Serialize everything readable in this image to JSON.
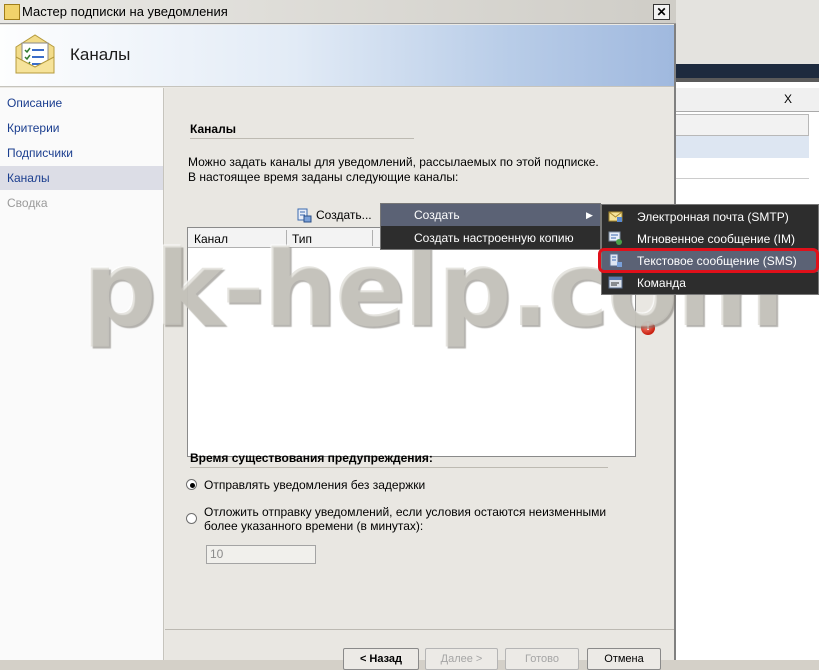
{
  "window": {
    "title": "Мастер подписки на уведомления"
  },
  "banner": {
    "title": "Каналы"
  },
  "sidebar": {
    "items": [
      {
        "label": "Описание"
      },
      {
        "label": "Критерии"
      },
      {
        "label": "Подписчики"
      },
      {
        "label": "Каналы"
      },
      {
        "label": "Сводка"
      }
    ],
    "selected": "Каналы"
  },
  "main": {
    "section_title": "Каналы",
    "description": "Можно задать каналы для уведомлений, рассылаемых по этой подписке. В настоящее время заданы следующие каналы:",
    "create_button": "Создать...",
    "grid": {
      "columns": [
        "Канал",
        "Тип"
      ]
    },
    "warning_section": {
      "title": "Время существования предупреждения:",
      "option1": "Отправлять уведомления без задержки",
      "option2": "Отложить отправку уведомлений, если условия остаются неизменными более указанного времени (в минутах):",
      "selected": "option1",
      "delay_value": "10"
    }
  },
  "buttons": {
    "back": "< Назад",
    "next": "Далее >",
    "finish": "Готово",
    "cancel": "Отмена"
  },
  "context_menu": {
    "items": [
      {
        "label": "Создать",
        "has_submenu": true
      },
      {
        "label": "Создать настроенную копию"
      }
    ]
  },
  "submenu": {
    "items": [
      {
        "label": "Электронная почта (SMTP)",
        "icon": "email-icon"
      },
      {
        "label": "Мгновенное сообщение (IM)",
        "icon": "instant-message-icon"
      },
      {
        "label": "Текстовое сообщение (SMS)",
        "icon": "sms-icon"
      },
      {
        "label": "Команда",
        "icon": "command-icon"
      }
    ],
    "highlighted": "Текстовое сообщение (SMS)"
  },
  "background_window": {
    "close_label": "X"
  },
  "watermark": "pk-help.com",
  "colors": {
    "menu_bg": "#2d2d2d",
    "menu_highlight": "#5b6275",
    "annotation_red": "#e0101a",
    "link_blue": "#1b3e8f"
  }
}
